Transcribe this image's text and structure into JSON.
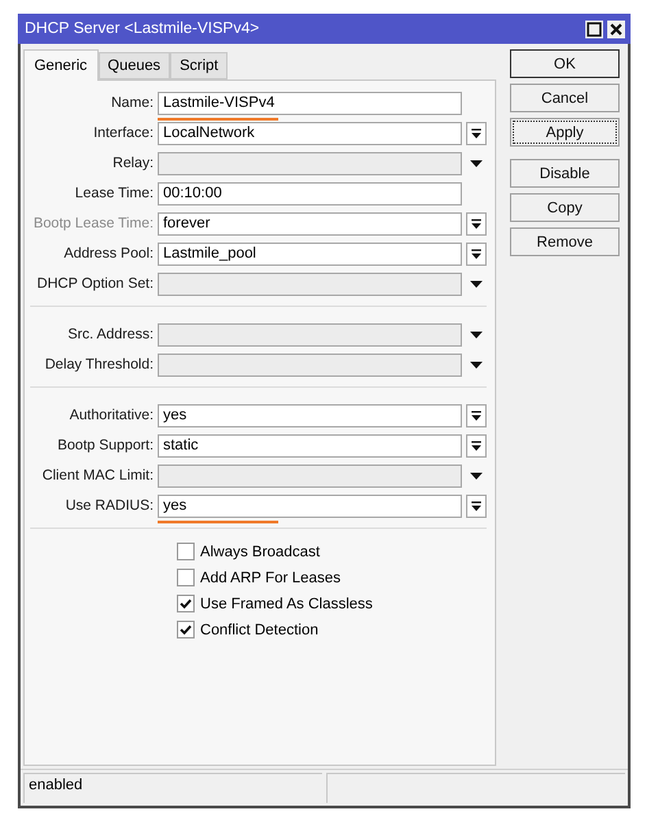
{
  "window": {
    "title": "DHCP Server <Lastmile-VISPv4>"
  },
  "tabs": [
    {
      "label": "Generic",
      "selected": true
    },
    {
      "label": "Queues",
      "selected": false
    },
    {
      "label": "Script",
      "selected": false
    }
  ],
  "sections": [
    {
      "rows": [
        {
          "label": "Name:",
          "kind": "text",
          "value": "Lastmile-VISPv4",
          "disabled": false,
          "highlighted": true
        },
        {
          "label": "Interface:",
          "kind": "select",
          "value": "LocalNetwork",
          "disabled": false,
          "highlighted": false
        },
        {
          "label": "Relay:",
          "kind": "empty",
          "disabled": false,
          "highlighted": false
        },
        {
          "label": "Lease Time:",
          "kind": "text",
          "value": "00:10:00",
          "disabled": false,
          "highlighted": false
        },
        {
          "label": "Bootp Lease Time:",
          "kind": "select",
          "value": "forever",
          "disabled": true,
          "highlighted": false
        },
        {
          "label": "Address Pool:",
          "kind": "select",
          "value": "Lastmile_pool",
          "disabled": false,
          "highlighted": false
        },
        {
          "label": "DHCP Option Set:",
          "kind": "empty",
          "disabled": false,
          "highlighted": false
        }
      ]
    },
    {
      "rows": [
        {
          "label": "Src. Address:",
          "kind": "empty",
          "disabled": false,
          "highlighted": false
        },
        {
          "label": "Delay Threshold:",
          "kind": "empty",
          "disabled": false,
          "highlighted": false
        }
      ]
    },
    {
      "rows": [
        {
          "label": "Authoritative:",
          "kind": "select",
          "value": "yes",
          "disabled": false,
          "highlighted": false
        },
        {
          "label": "Bootp Support:",
          "kind": "select",
          "value": "static",
          "disabled": false,
          "highlighted": false
        },
        {
          "label": "Client MAC Limit:",
          "kind": "empty",
          "disabled": false,
          "highlighted": false
        },
        {
          "label": "Use RADIUS:",
          "kind": "select",
          "value": "yes",
          "disabled": false,
          "highlighted": true
        }
      ]
    }
  ],
  "checkboxes": [
    {
      "label": "Always Broadcast",
      "checked": false
    },
    {
      "label": "Add ARP For Leases",
      "checked": false
    },
    {
      "label": "Use Framed As Classless",
      "checked": true
    },
    {
      "label": "Conflict Detection",
      "checked": true
    }
  ],
  "button_groups": [
    [
      {
        "label": "OK",
        "kind": "default"
      },
      {
        "label": "Cancel",
        "kind": "normal"
      },
      {
        "label": "Apply",
        "kind": "focused"
      }
    ],
    [
      {
        "label": "Disable",
        "kind": "normal"
      },
      {
        "label": "Copy",
        "kind": "normal"
      },
      {
        "label": "Remove",
        "kind": "normal"
      }
    ]
  ],
  "status_bar": {
    "text": "enabled"
  }
}
